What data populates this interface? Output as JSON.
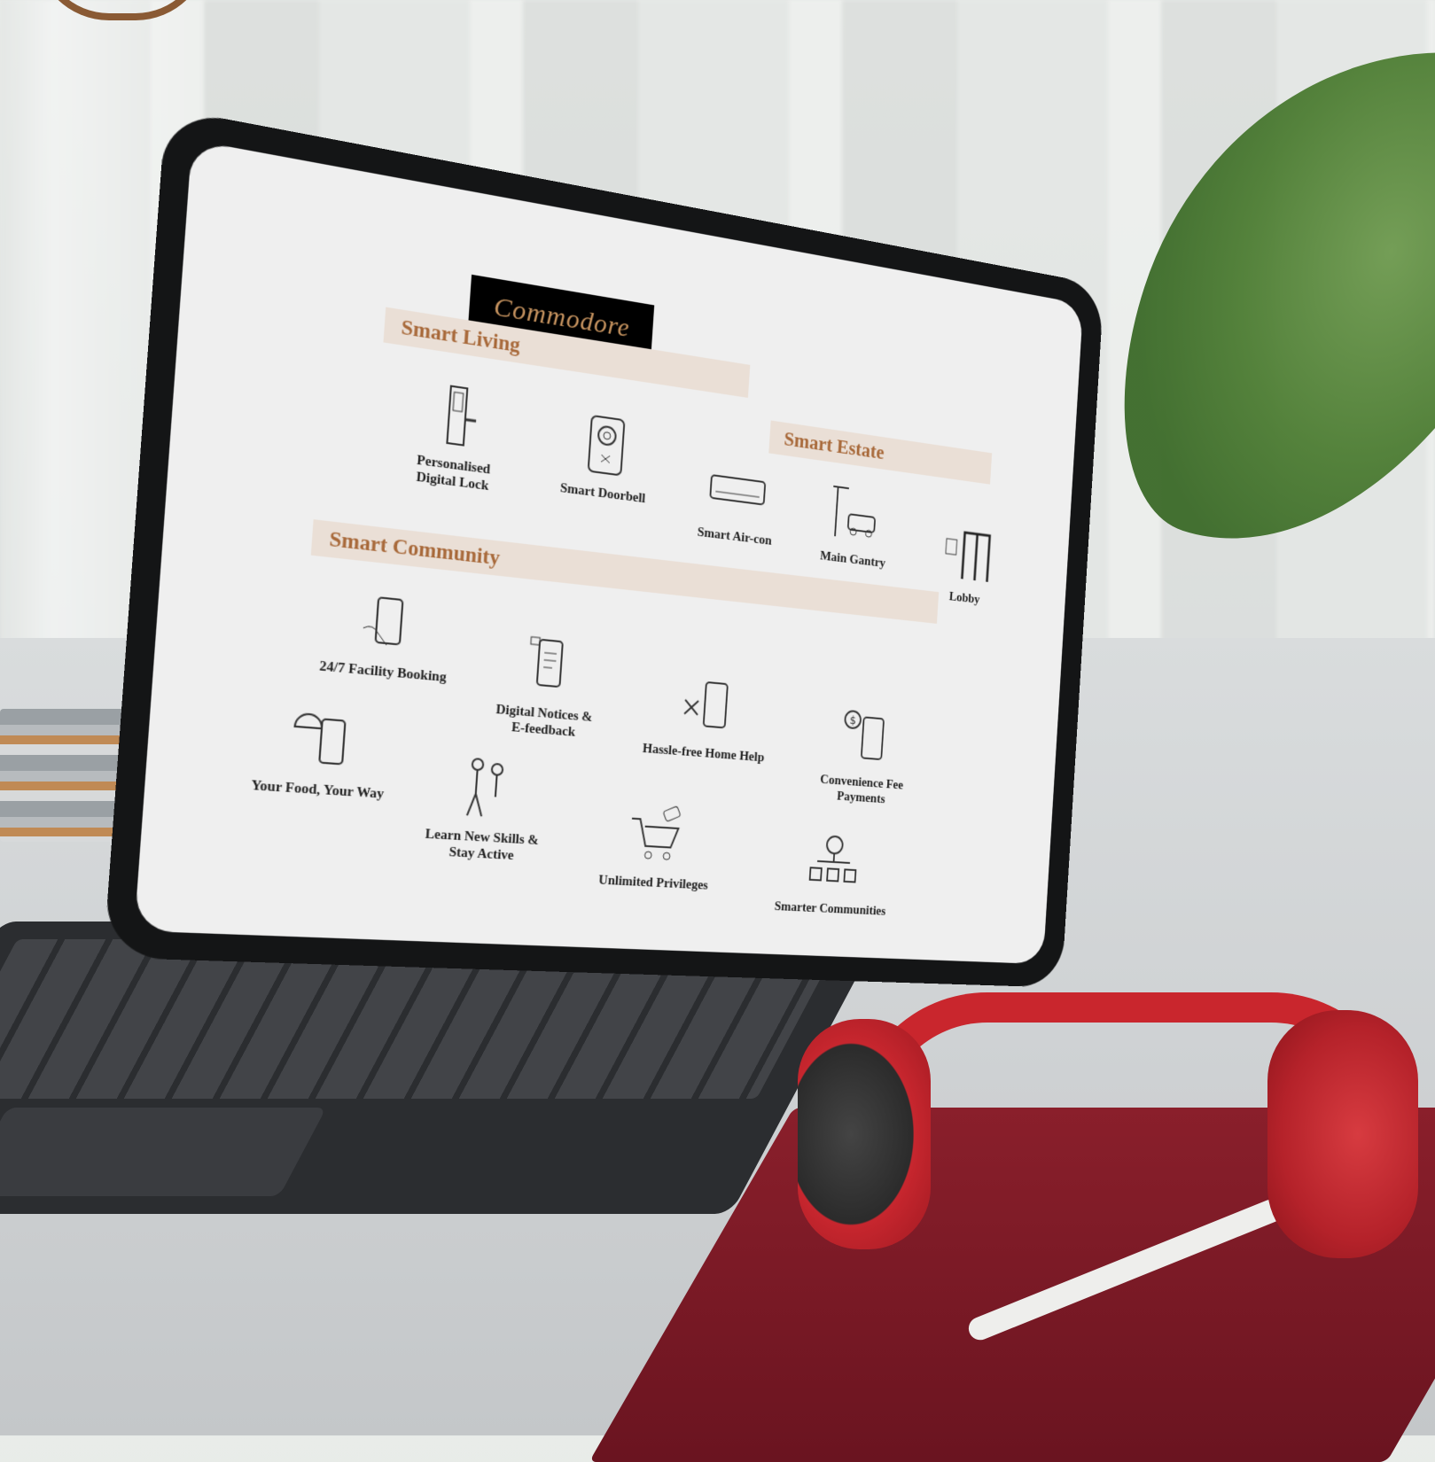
{
  "screen": {
    "brand": "Commodore",
    "sections": {
      "smart_living": "Smart Living",
      "smart_estate": "Smart Estate",
      "smart_community": "Smart Community"
    },
    "smart_living_items": [
      {
        "label": "Personalised\nDigital Lock",
        "icon": "digital-lock-icon"
      },
      {
        "label": "Smart Doorbell",
        "icon": "doorbell-icon"
      },
      {
        "label": "Smart Air-con",
        "icon": "aircon-icon"
      }
    ],
    "smart_estate_items": [
      {
        "label": "Main Gantry",
        "icon": "gantry-icon"
      },
      {
        "label": "Lobby",
        "icon": "lobby-icon"
      }
    ],
    "smart_community_items": [
      {
        "label": "24/7 Facility Booking",
        "icon": "facility-booking-icon"
      },
      {
        "label": "Digital Notices &\nE-feedback",
        "icon": "notices-icon"
      },
      {
        "label": "Hassle-free Home Help",
        "icon": "home-help-icon"
      },
      {
        "label": "Convenience Fee\nPayments",
        "icon": "payment-icon"
      },
      {
        "label": "Your Food, Your Way",
        "icon": "food-icon"
      },
      {
        "label": "Learn New Skills &\nStay Active",
        "icon": "skills-icon"
      },
      {
        "label": "Unlimited Privileges",
        "icon": "shopping-cart-icon"
      },
      {
        "label": "Smarter Communities",
        "icon": "community-icon"
      }
    ]
  },
  "colors": {
    "accent_brown": "#a8693a",
    "section_band": "#eadfd6",
    "brand_box": "#000000",
    "headphones_red": "#c9262d",
    "notebook_red": "#8a1f2b",
    "leaf_green": "#4d7d33"
  }
}
